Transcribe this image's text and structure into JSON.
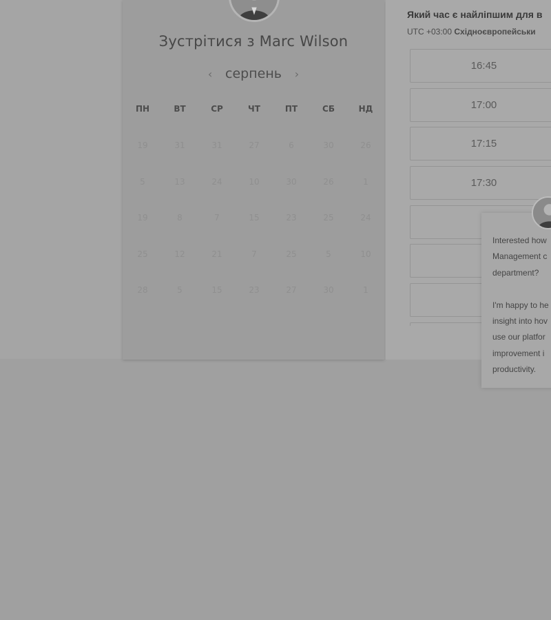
{
  "meeting": {
    "title": "Зустрітися з Marc Wilson"
  },
  "calendar": {
    "month": "серпень",
    "prev_icon": "chevron-left-icon",
    "next_icon": "chevron-right-icon",
    "weekdays": [
      "ПН",
      "ВТ",
      "СР",
      "ЧТ",
      "ПТ",
      "СБ",
      "НД"
    ],
    "weeks": [
      [
        "19",
        "31",
        "31",
        "27",
        "6",
        "30",
        "26"
      ],
      [
        "5",
        "13",
        "24",
        "10",
        "30",
        "26",
        "1"
      ],
      [
        "19",
        "8",
        "7",
        "15",
        "23",
        "25",
        "24"
      ],
      [
        "25",
        "12",
        "21",
        "7",
        "25",
        "5",
        "10"
      ],
      [
        "28",
        "5",
        "15",
        "23",
        "27",
        "30",
        "1"
      ]
    ]
  },
  "time_picker": {
    "question": "Який час є найліпшим для в",
    "timezone_prefix": "UTC +03:00",
    "timezone_name": "Східноєвропейськи",
    "slots": [
      "16:45",
      "17:00",
      "17:15",
      "17:30",
      "",
      "",
      "",
      ""
    ]
  },
  "chat": {
    "lines_p1": [
      "Interested how",
      "Management c",
      "department?"
    ],
    "lines_p2": [
      "I'm happy to he",
      "insight into hov",
      "use our platfor",
      "improvement i",
      "productivity."
    ]
  },
  "colors": {
    "overlay_gray": "#a5a5a5",
    "card_gray": "#9d9d9d"
  }
}
